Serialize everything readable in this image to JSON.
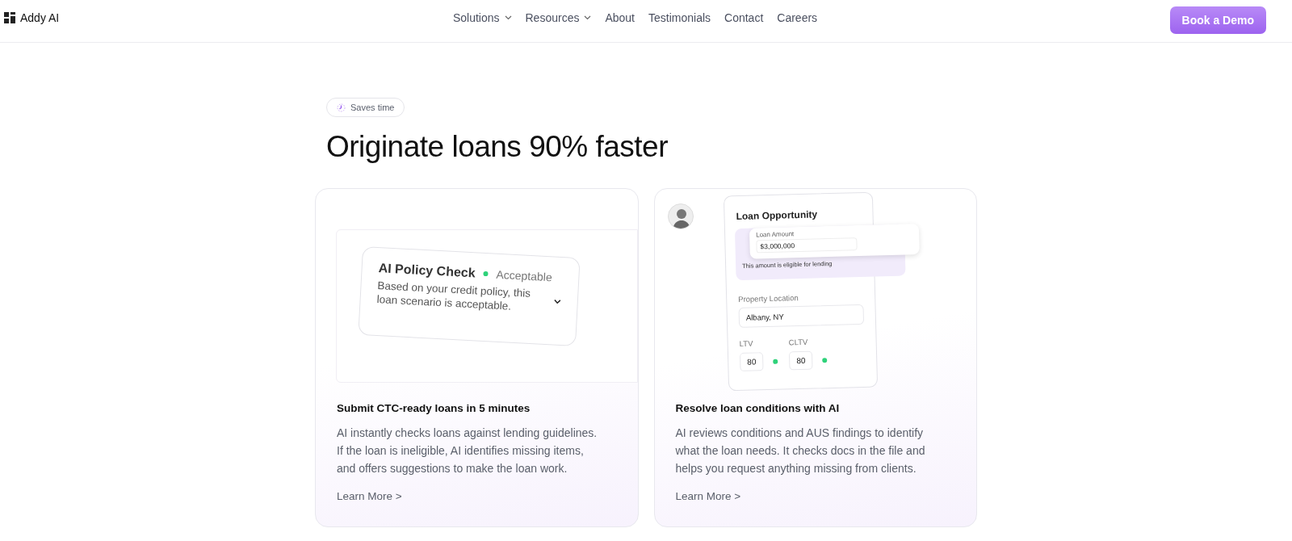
{
  "header": {
    "logo": "Addy AI",
    "nav": [
      {
        "label": "Solutions",
        "has_menu": true
      },
      {
        "label": "Resources",
        "has_menu": true
      },
      {
        "label": "About",
        "has_menu": false
      },
      {
        "label": "Testimonials",
        "has_menu": false
      },
      {
        "label": "Contact",
        "has_menu": false
      },
      {
        "label": "Careers",
        "has_menu": false
      }
    ],
    "cta": "Book a Demo"
  },
  "hero": {
    "badge": "Saves time",
    "title": "Originate loans 90% faster"
  },
  "cards": [
    {
      "kind": "policy",
      "mockup": {
        "title": "AI Policy Check",
        "status": "Acceptable",
        "color": "#2fd27a",
        "text": "Based on your credit policy, this loan scenario is acceptable."
      },
      "title": "Submit CTC-ready loans in 5 minutes",
      "body": "AI instantly checks loans against lending guidelines. If the loan is ineligible, AI identifies missing items, and offers suggestions to make the loan work.",
      "link": "Learn More >"
    },
    {
      "kind": "loan",
      "mockup": {
        "title": "Loan Opportunity",
        "amount_label": "Loan Amount",
        "amount": "$3,000,000",
        "amount_note": "This amount is eligible for lending",
        "location_label": "Property Location",
        "location": "Albany, NY",
        "ratios": [
          {
            "label": "LTV",
            "value": "80",
            "color": "#2fd27a"
          },
          {
            "label": "CLTV",
            "value": "80",
            "color": "#2fd27a"
          }
        ]
      },
      "title": "Resolve loan conditions with AI",
      "body": "AI reviews conditions and AUS findings to identify what the loan needs. It checks docs in the file and helps you request anything missing from clients.",
      "link": "Learn More >"
    }
  ]
}
